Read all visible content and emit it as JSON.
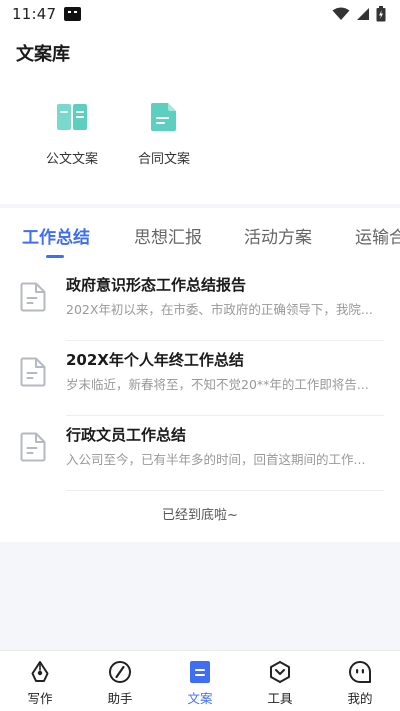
{
  "status": {
    "time": "11:47"
  },
  "header": {
    "title": "文案库"
  },
  "quick_entries": [
    {
      "label": "公文文案",
      "icon": "book-icon",
      "color": "#5ccfc0"
    },
    {
      "label": "合同文案",
      "icon": "document-icon",
      "color": "#5ccfc0"
    }
  ],
  "tabs": [
    {
      "label": "工作总结",
      "active": true
    },
    {
      "label": "思想汇报",
      "active": false
    },
    {
      "label": "活动方案",
      "active": false
    },
    {
      "label": "运输合",
      "active": false
    }
  ],
  "articles": [
    {
      "title": "政府意识形态工作总结报告",
      "desc": "202X年初以来，在市委、市政府的正确领导下，我院..."
    },
    {
      "title": "202X年个人年终工作总结",
      "desc": "岁末临近，新春将至，不知不觉20**年的工作即将告..."
    },
    {
      "title": "行政文员工作总结",
      "desc": "入公司至今，已有半年多的时间，回首这期间的工作..."
    }
  ],
  "list_end": "已经到底啦~",
  "nav": [
    {
      "label": "写作",
      "icon": "pen-nib-icon",
      "active": false
    },
    {
      "label": "助手",
      "icon": "compass-icon",
      "active": false
    },
    {
      "label": "文案",
      "icon": "document-icon",
      "active": true
    },
    {
      "label": "工具",
      "icon": "hexagon-icon",
      "active": false
    },
    {
      "label": "我的",
      "icon": "profile-icon",
      "active": false
    }
  ],
  "colors": {
    "accent": "#3f6ef3",
    "teal": "#5ccfc0"
  }
}
